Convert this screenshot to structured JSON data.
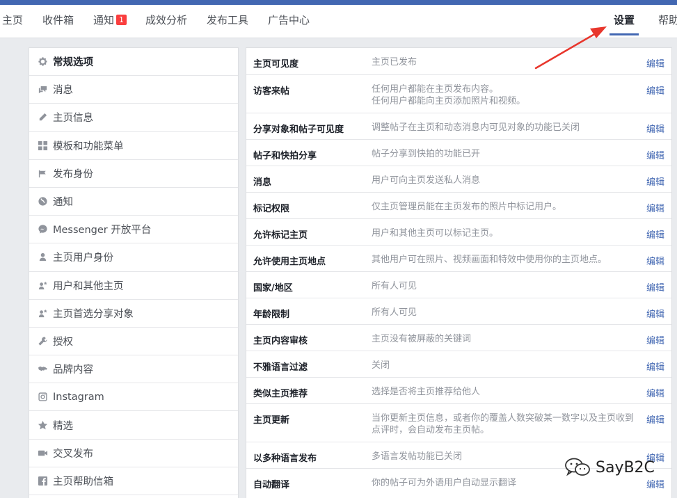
{
  "tabs": [
    {
      "label": "主页"
    },
    {
      "label": "收件箱"
    },
    {
      "label": "通知",
      "badge": "1"
    },
    {
      "label": "成效分析"
    },
    {
      "label": "发布工具"
    },
    {
      "label": "广告中心"
    },
    {
      "label": "设置"
    },
    {
      "label": "帮助"
    }
  ],
  "sidebar": {
    "items": [
      {
        "label": "常规选项",
        "icon": "gear-icon"
      },
      {
        "label": "消息",
        "icon": "message-icon"
      },
      {
        "label": "主页信息",
        "icon": "pencil-icon"
      },
      {
        "label": "模板和功能菜单",
        "icon": "grid-icon"
      },
      {
        "label": "发布身份",
        "icon": "flag-icon"
      },
      {
        "label": "通知",
        "icon": "globe-icon"
      },
      {
        "label": "Messenger 开放平台",
        "icon": "messenger-icon"
      },
      {
        "label": "主页用户身份",
        "icon": "person-icon"
      },
      {
        "label": "用户和其他主页",
        "icon": "person-star-icon"
      },
      {
        "label": "主页首选分享对象",
        "icon": "person-star-icon"
      },
      {
        "label": "授权",
        "icon": "wrench-icon"
      },
      {
        "label": "品牌内容",
        "icon": "handshake-icon"
      },
      {
        "label": "Instagram",
        "icon": "instagram-icon"
      },
      {
        "label": "精选",
        "icon": "star-icon"
      },
      {
        "label": "交叉发布",
        "icon": "video-icon"
      },
      {
        "label": "主页帮助信箱",
        "icon": "facebook-icon"
      }
    ]
  },
  "settings": {
    "edit_label": "编辑",
    "rows": [
      {
        "label": "主页可见度",
        "value": "主页已发布"
      },
      {
        "label": "访客来帖",
        "value": "任何用户都能在主页发布内容。\n任何用户都能向主页添加照片和视频。"
      },
      {
        "label": "分享对象和帖子可见度",
        "value": "调整帖子在主页和动态消息内可见对象的功能已关闭"
      },
      {
        "label": "帖子和快拍分享",
        "value": "帖子分享到快拍的功能已开"
      },
      {
        "label": "消息",
        "value": "用户可向主页发送私人消息"
      },
      {
        "label": "标记权限",
        "value": "仅主页管理员能在主页发布的照片中标记用户。"
      },
      {
        "label": "允许标记主页",
        "value": "用户和其他主页可以标记主页。"
      },
      {
        "label": "允许使用主页地点",
        "value": "其他用户可在照片、视频画面和特效中使用你的主页地点。"
      },
      {
        "label": "国家/地区",
        "value": "所有人可见"
      },
      {
        "label": "年龄限制",
        "value": "所有人可见"
      },
      {
        "label": "主页内容审核",
        "value": "主页没有被屏蔽的关键词"
      },
      {
        "label": "不雅语言过滤",
        "value": "关闭"
      },
      {
        "label": "类似主页推荐",
        "value": "选择是否将主页推荐给他人"
      },
      {
        "label": "主页更新",
        "value": "当你更新主页信息，或者你的覆盖人数突破某一数字以及主页收到点评时，会自动发布主页帖。"
      },
      {
        "label": "以多种语言发布",
        "value": "多语言发帖功能已关闭"
      },
      {
        "label": "自动翻译",
        "value": "你的帖子可为外语用户自动显示翻译"
      }
    ]
  },
  "watermark": {
    "text": "SayB2C"
  },
  "colors": {
    "brand": "#4267b2",
    "badge": "#fa3e3e",
    "arrow": "#e8362c"
  }
}
